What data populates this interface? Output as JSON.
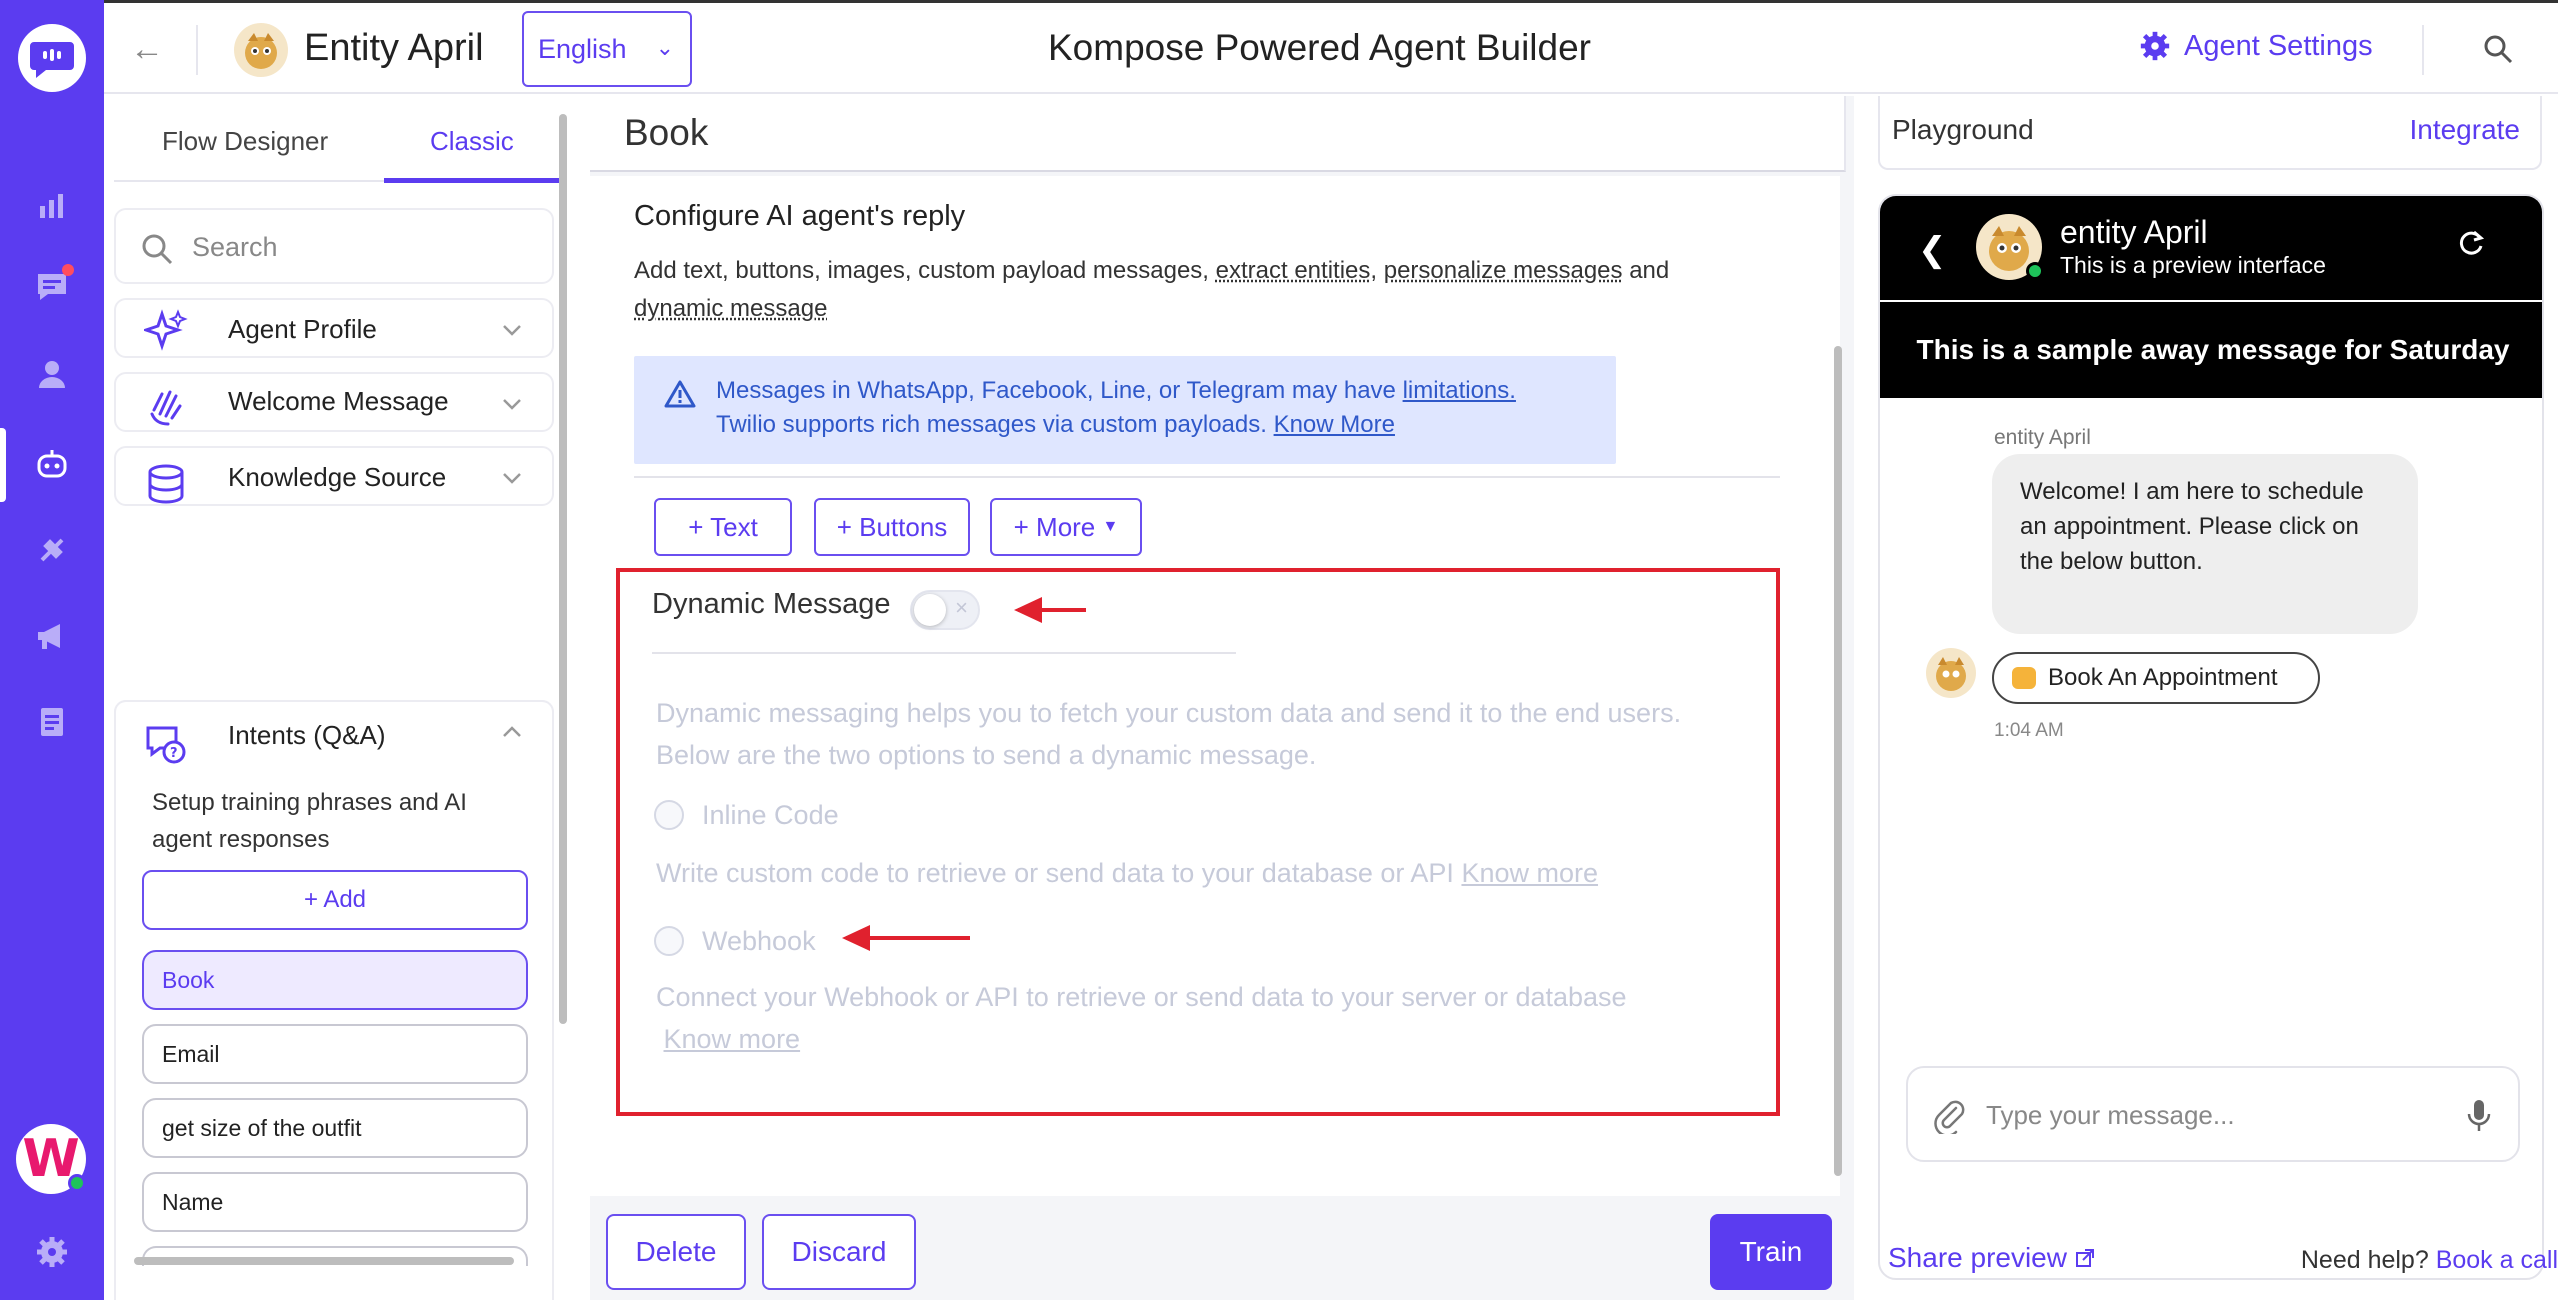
{
  "topbar": {
    "agent_name": "Entity April",
    "language": "English",
    "page_title": "Kompose Powered Agent Builder",
    "agent_settings_label": "Agent Settings"
  },
  "left": {
    "tabs": {
      "flow": "Flow Designer",
      "classic": "Classic"
    },
    "search_placeholder": "Search",
    "sections": {
      "agent_profile": "Agent Profile",
      "welcome_message": "Welcome Message",
      "knowledge_source": "Knowledge Source",
      "intents": "Intents (Q&A)"
    },
    "intents_desc": "Setup training phrases and AI agent responses",
    "add_label": "+ Add",
    "intent_items": [
      "Book",
      "Email",
      "get size of the outfit",
      "Name"
    ]
  },
  "center": {
    "title": "Book",
    "config_title": "Configure AI agent's reply",
    "config_desc_prefix": "Add text, buttons, images, custom payload messages,",
    "config_desc_link1": "extract entities",
    "config_desc_link2": "personalize messages",
    "config_desc_and": "and",
    "config_desc_link3": "dynamic message",
    "warning_line1": "Messages in WhatsApp, Facebook, Line, or Telegram may have",
    "warning_link1": "limitations.",
    "warning_line2": "Twilio supports rich messages via custom payloads.",
    "warning_link2": "Know More",
    "chips": {
      "text": "+ Text",
      "buttons": "+ Buttons",
      "more": "+ More"
    },
    "dynamic": {
      "title": "Dynamic Message",
      "toggle_on": false,
      "desc1": "Dynamic messaging helps you to fetch your custom data and send it to the end users.",
      "desc2": "Below are the two options to send a dynamic message.",
      "inline_label": "Inline Code",
      "inline_desc": "Write custom code to retrieve or send data to your database or API",
      "inline_link": "Know more",
      "webhook_label": "Webhook",
      "webhook_desc": "Connect your Webhook or API to retrieve or send data to your server or database",
      "webhook_link": "Know more"
    },
    "buttons": {
      "delete": "Delete",
      "discard": "Discard",
      "train": "Train"
    }
  },
  "playground": {
    "title": "Playground",
    "integrate": "Integrate",
    "bot_name": "entity April",
    "bot_sub": "This is a preview interface",
    "away_message": "This is a sample away message for Saturday",
    "sender": "entity April",
    "welcome": "Welcome! I am here to schedule an appointment. Please click on the below button.",
    "chip_label": "Book An Appointment",
    "time": "1:04 AM",
    "input_placeholder": "Type your message...",
    "share_preview": "Share preview",
    "need_help": "Need help?",
    "book_call": "Book a call"
  },
  "colors": {
    "accent": "#5b3cf0",
    "highlight": "#e0212e",
    "warning_bg": "#dfe6ff"
  }
}
